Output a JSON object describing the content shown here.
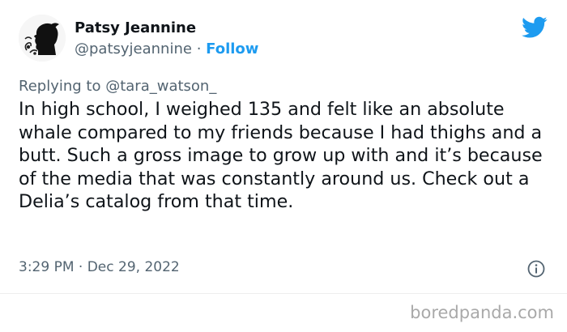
{
  "author": {
    "name": "Patsy Jeannine",
    "handle": "@patsyjeannine",
    "separator": "·",
    "follow_label": "Follow"
  },
  "replying": {
    "prefix": "Replying to ",
    "to": "@tara_watson_"
  },
  "tweet": {
    "text": "In high school, I weighed 135 and felt like an absolute whale compared to my friends because I had thighs and a butt. Such a gross image to grow up with and it’s because of the media that was constantly around us. Check out a Delia’s catalog from that time.",
    "time": "3:29 PM",
    "separator": "·",
    "date": "Dec 29, 2022"
  },
  "watermark": "boredpanda.com",
  "colors": {
    "accent": "#1d9bf0",
    "secondary_text": "#536471",
    "primary_text": "#0f1419"
  },
  "icons": {
    "platform": "twitter-bird-icon",
    "info": "info-icon"
  }
}
